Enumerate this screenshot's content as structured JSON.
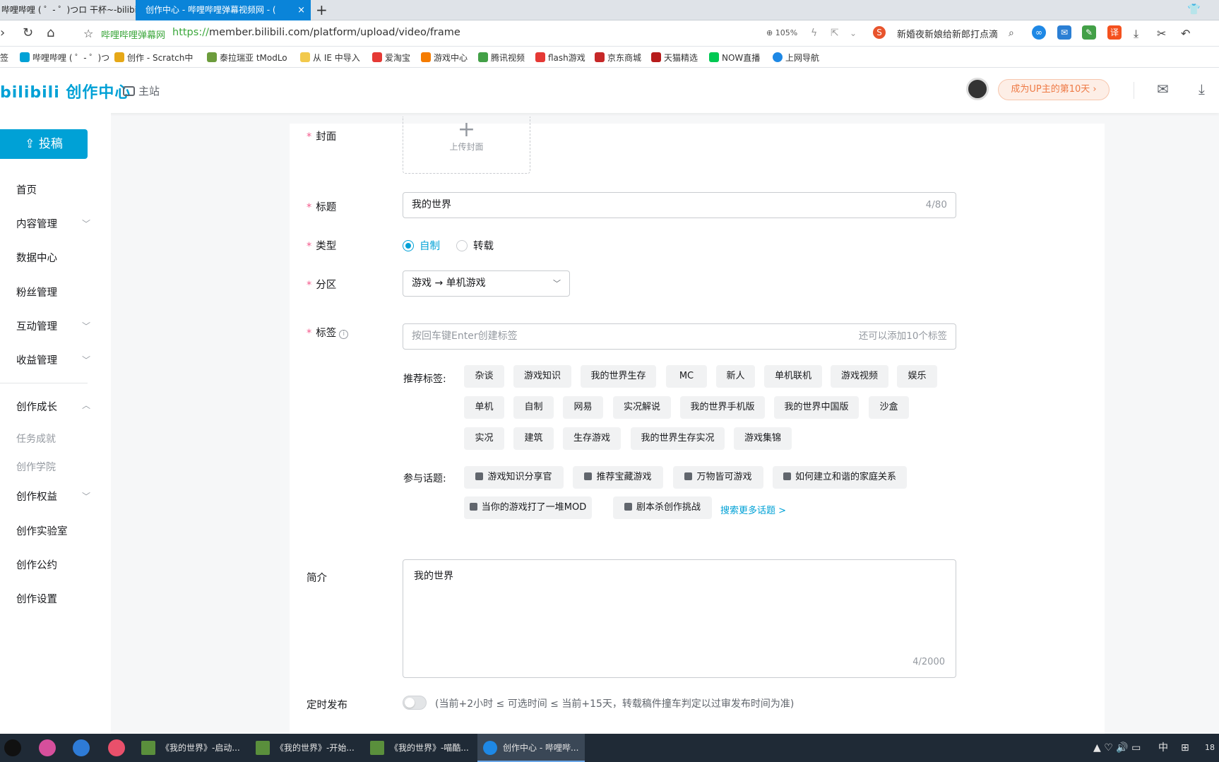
{
  "browser": {
    "tabs": [
      {
        "title": "哔哩哔哩 ( ゜- ゜)つロ 干杯~-bilibili"
      },
      {
        "title": "创作中心 - 哔哩哔哩弹幕视频网 - ("
      }
    ],
    "new_tab": "+",
    "close": "×",
    "url_site": "哔哩哔哩弹幕网",
    "url_proto": "https://",
    "url_rest": "member.bilibili.com/platform/upload/video/frame",
    "zoom": "105%",
    "news": "新婚夜新娘给新郎打点滴",
    "bookmarks": [
      "签",
      "哔哩哔哩 ( ゜- ゜)つ",
      "创作 - Scratch中",
      "泰拉瑞亚 tModLo",
      "从 IE 中导入",
      "爱淘宝",
      "游戏中心",
      "腾讯视频",
      "flash游戏",
      "京东商城",
      "天猫精选",
      "NOW直播",
      "上网导航"
    ]
  },
  "header": {
    "logo": "bilibili 创作中心",
    "mainsite": "主站",
    "up_badge": "成为UP主的第10天 ›"
  },
  "sidebar": {
    "upload": "投稿",
    "items": [
      {
        "label": "首页"
      },
      {
        "label": "内容管理"
      },
      {
        "label": "数据中心"
      },
      {
        "label": "粉丝管理"
      },
      {
        "label": "互动管理"
      },
      {
        "label": "收益管理"
      },
      {
        "label": "创作成长"
      },
      {
        "label": "任务成就"
      },
      {
        "label": "创作学院"
      },
      {
        "label": "创作权益"
      },
      {
        "label": "创作实验室"
      },
      {
        "label": "创作公约"
      },
      {
        "label": "创作设置"
      }
    ]
  },
  "form": {
    "cover_label": "封面",
    "cover_upload": "上传封面",
    "title_label": "标题",
    "title_value": "我的世界",
    "title_count": "4/80",
    "type_label": "类型",
    "type_options": [
      "自制",
      "转载"
    ],
    "zone_label": "分区",
    "zone_value": "游戏 → 单机游戏",
    "tags_label": "标签",
    "tags_placeholder": "按回车键Enter创建标签",
    "tags_remaining": "还可以添加10个标签",
    "recommended_label": "推荐标签:",
    "recommended_tags": [
      "杂谈",
      "游戏知识",
      "我的世界生存",
      "MC",
      "新人",
      "单机联机",
      "游戏视频",
      "娱乐",
      "单机",
      "自制",
      "网易",
      "实况解说",
      "我的世界手机版",
      "我的世界中国版",
      "沙盒",
      "实况",
      "建筑",
      "生存游戏",
      "我的世界生存实况",
      "游戏集锦"
    ],
    "topics_label": "参与话题:",
    "topics": [
      "游戏知识分享官",
      "推荐宝藏游戏",
      "万物皆可游戏",
      "如何建立和谐的家庭关系",
      "当你的游戏打了一堆MOD",
      "剧本杀创作挑战"
    ],
    "more_topics": "搜索更多话题 >",
    "desc_label": "简介",
    "desc_value": "我的世界",
    "desc_count": "4/2000",
    "schedule_label": "定时发布",
    "schedule_note": "(当前+2小时 ≤ 可选时间 ≤ 当前+15天，转载稿件撞车判定以过审发布时间为准)"
  },
  "taskbar": {
    "tasks": [
      "《我的世界》-启动...",
      "《我的世界》-开始...",
      "《我的世界》-喵酷...",
      "创作中心 - 哔哩哔..."
    ],
    "ime": "中",
    "clock": "18"
  },
  "colors": {
    "accent": "#00a1d6",
    "required": "#f45a8d",
    "up_badge": "#ee7a45"
  }
}
